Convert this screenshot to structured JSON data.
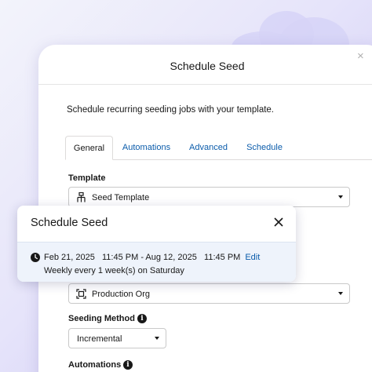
{
  "modal": {
    "title": "Schedule Seed",
    "close_glyph": "×",
    "description": "Schedule recurring seeding jobs with your template."
  },
  "tabs": [
    {
      "label": "General",
      "active": true
    },
    {
      "label": "Automations",
      "active": false
    },
    {
      "label": "Advanced",
      "active": false
    },
    {
      "label": "Schedule",
      "active": false
    }
  ],
  "template": {
    "label": "Template",
    "value": "Seed Template",
    "icon": "hierarchy-icon"
  },
  "target": {
    "value": "Production Org",
    "icon": "org-frame-icon"
  },
  "seeding_method": {
    "label": "Seeding Method",
    "value": "Incremental",
    "info_glyph": "i"
  },
  "automations": {
    "label": "Automations",
    "info_glyph": "i"
  },
  "popover": {
    "title": "Schedule Seed",
    "close_glyph": "×",
    "range": "Feb 21, 2025   11:45 PM - Aug 12, 2025   11:45 PM",
    "edit_label": "Edit",
    "recurrence": "Weekly every 1 week(s) on Saturday",
    "icon": "clock-icon"
  },
  "colors": {
    "link": "#0b5cab",
    "text": "#181818",
    "popover_body": "#eef3fb"
  }
}
